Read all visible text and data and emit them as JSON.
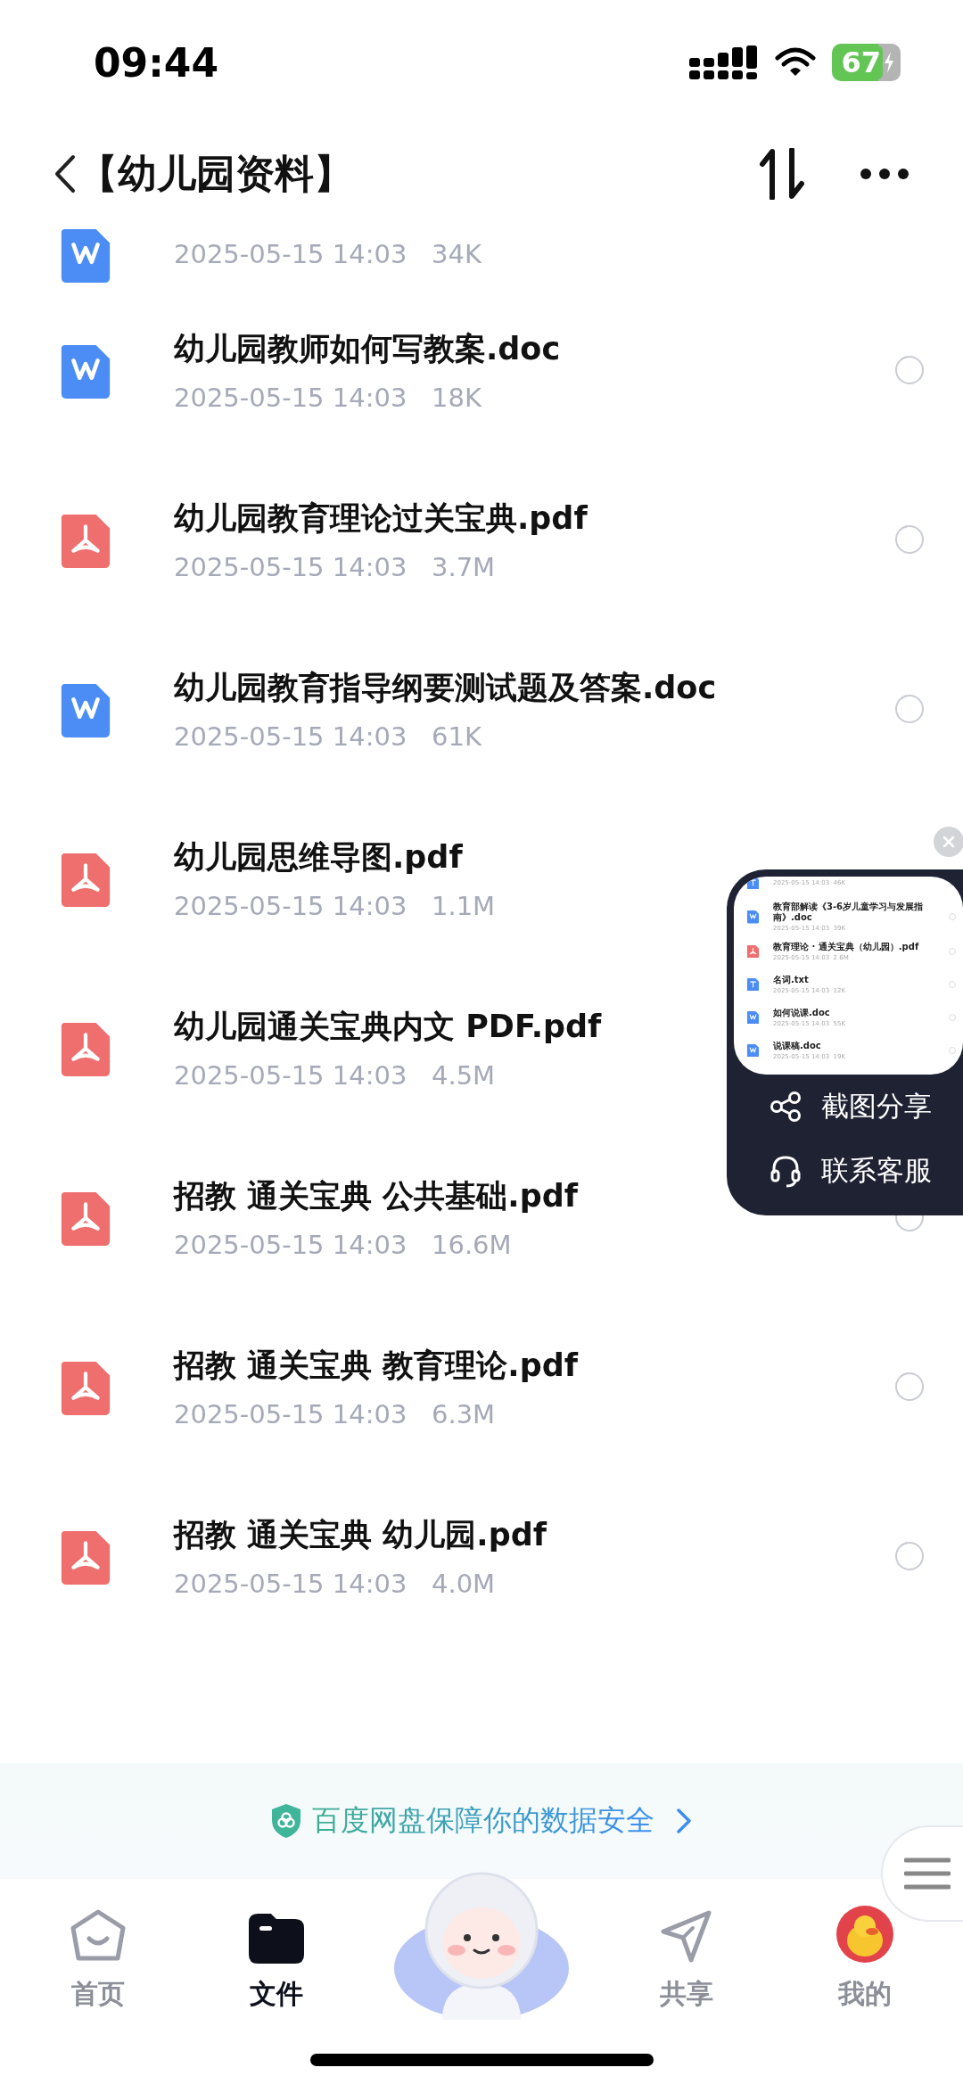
{
  "status_bar": {
    "time": "09:44",
    "battery": "67"
  },
  "header": {
    "title": "【幼儿园资料】"
  },
  "files": [
    {
      "kind": "doc",
      "date": "2025-05-15 14:03",
      "size": "34K"
    },
    {
      "kind": "doc",
      "name": "幼儿园教师如何写教案.doc",
      "date": "2025-05-15 14:03",
      "size": "18K",
      "selected": false
    },
    {
      "kind": "pdf",
      "name": "幼儿园教育理论过关宝典.pdf",
      "date": "2025-05-15 14:03",
      "size": "3.7M",
      "selected": false
    },
    {
      "kind": "doc",
      "name": "幼儿园教育指导纲要测试题及答案.doc",
      "date": "2025-05-15 14:03",
      "size": "61K",
      "selected": false
    },
    {
      "kind": "pdf",
      "name": "幼儿园思维导图.pdf",
      "date": "2025-05-15 14:03",
      "size": "1.1M"
    },
    {
      "kind": "pdf",
      "name": "幼儿园通关宝典内文 PDF.pdf",
      "date": "2025-05-15 14:03",
      "size": "4.5M"
    },
    {
      "kind": "pdf",
      "name": "招教 通关宝典 公共基础.pdf",
      "date": "2025-05-15 14:03",
      "size": "16.6M",
      "selected": false
    },
    {
      "kind": "pdf",
      "name": "招教 通关宝典 教育理论.pdf",
      "date": "2025-05-15 14:03",
      "size": "6.3M",
      "selected": false
    },
    {
      "kind": "pdf",
      "name": "招教 通关宝典 幼儿园.pdf",
      "date": "2025-05-15 14:03",
      "size": "4.0M",
      "selected": false
    }
  ],
  "screenshot_panel": {
    "files": [
      {
        "kind": "txt",
        "date": "2025-05-15 14:03",
        "size": "46K"
      },
      {
        "kind": "doc",
        "name": "教育部解读《3-6岁儿童学习与发展指南》.doc",
        "date": "2025-05-15 14:03",
        "size": "39K"
      },
      {
        "kind": "pdf",
        "name": "教育理论 · 通关宝典（幼儿园）.pdf",
        "date": "2025-05-15 14:03",
        "size": "2.6M"
      },
      {
        "kind": "txt",
        "name": "名词.txt",
        "date": "2025-05-15 14:03",
        "size": "12K"
      },
      {
        "kind": "doc",
        "name": "如何说课.doc",
        "date": "2025-05-15 14:03",
        "size": "55K"
      },
      {
        "kind": "doc",
        "name": "说课稿.doc",
        "date": "2025-05-15 14:03",
        "size": "19K"
      }
    ],
    "actions": [
      {
        "kind": "share",
        "label": "截图分享"
      },
      {
        "kind": "support",
        "label": "联系客服"
      }
    ]
  },
  "banner": {
    "text": "百度网盘保障你的数据安全"
  },
  "nav": [
    {
      "kind": "home",
      "label": "首页",
      "selected": false
    },
    {
      "kind": "files",
      "label": "文件",
      "selected": true
    },
    {
      "kind": "assistant",
      "selected": false
    },
    {
      "kind": "share",
      "label": "共享",
      "selected": false
    },
    {
      "kind": "me",
      "label": "我的",
      "selected": false
    }
  ]
}
